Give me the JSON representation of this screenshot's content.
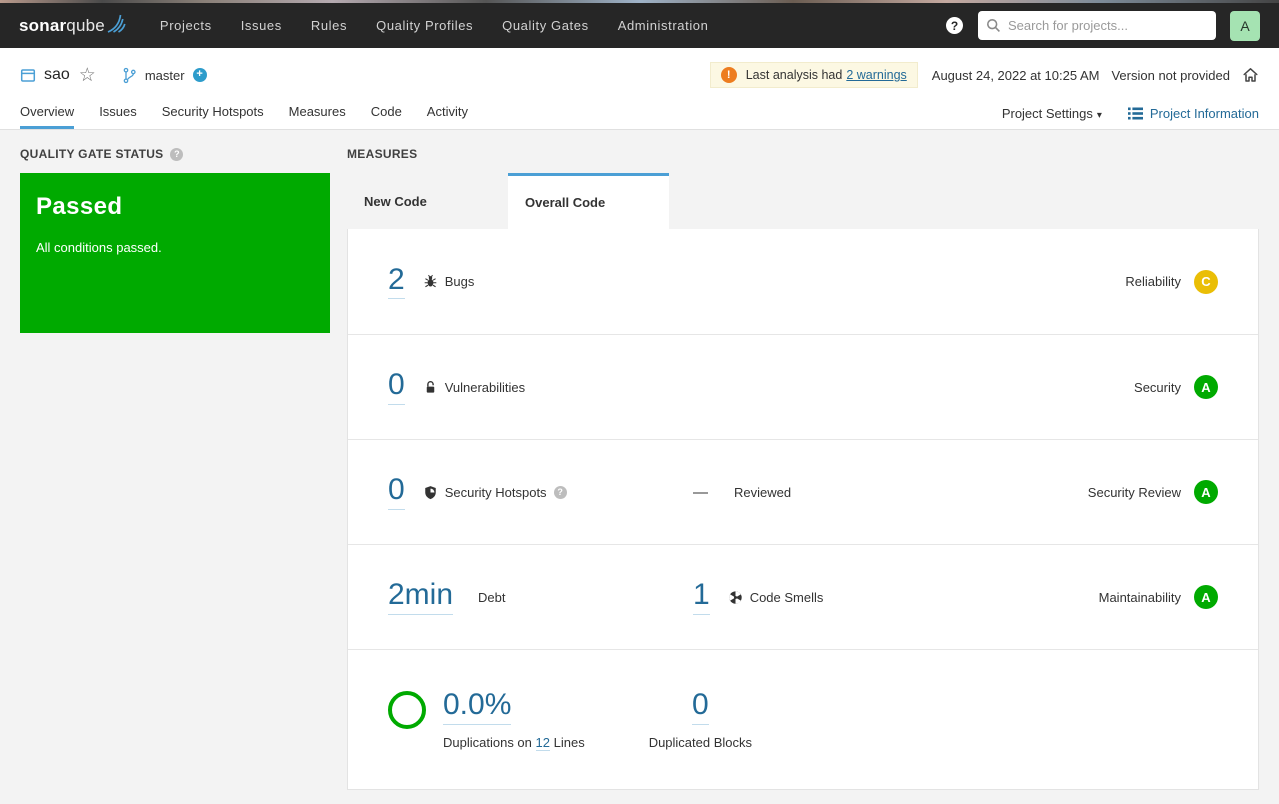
{
  "colors": {
    "navbar_bg": "#262626",
    "brand_blue": "#4b9fd5",
    "link_blue": "#236a97",
    "passed_green": "#00aa00",
    "rating_a": "#00aa00",
    "rating_c": "#eabe06",
    "warning_orange": "#ed7d20",
    "avatar_green": "#a5e3b2"
  },
  "icons": {
    "help": "?",
    "warning": "!",
    "star": "☆",
    "caret_down": "▾",
    "plus": "+"
  },
  "topnav": {
    "logo": {
      "bold": "sonar",
      "light": "qube"
    },
    "items": [
      {
        "label": "Projects"
      },
      {
        "label": "Issues"
      },
      {
        "label": "Rules"
      },
      {
        "label": "Quality Profiles"
      },
      {
        "label": "Quality Gates"
      },
      {
        "label": "Administration"
      }
    ],
    "search": {
      "placeholder": "Search for projects..."
    },
    "avatar": "A"
  },
  "header": {
    "project": "sao",
    "branch": "master",
    "warning": {
      "text": "Last analysis had",
      "link": "2 warnings"
    },
    "analysis_date": "August 24, 2022 at 10:25 AM",
    "version": "Version not provided",
    "tabs": [
      {
        "label": "Overview"
      },
      {
        "label": "Issues"
      },
      {
        "label": "Security Hotspots"
      },
      {
        "label": "Measures"
      },
      {
        "label": "Code"
      },
      {
        "label": "Activity"
      }
    ],
    "project_settings": "Project Settings",
    "project_information": "Project Information"
  },
  "quality_gate": {
    "heading": "QUALITY GATE STATUS",
    "status": "Passed",
    "description": "All conditions passed."
  },
  "measures": {
    "heading": "MEASURES",
    "tabs": [
      {
        "label": "New Code"
      },
      {
        "label": "Overall Code"
      }
    ],
    "rows": [
      {
        "value": "2",
        "metric": "Bugs",
        "domain": "Reliability",
        "rating": "C"
      },
      {
        "value": "0",
        "metric": "Vulnerabilities",
        "domain": "Security",
        "rating": "A"
      },
      {
        "value": "0",
        "metric": "Security Hotspots",
        "reviewed_value": "—",
        "reviewed_label": "Reviewed",
        "domain": "Security Review",
        "rating": "A"
      },
      {
        "value": "2min",
        "metric": "Debt",
        "secondary_value": "1",
        "secondary_metric": "Code Smells",
        "domain": "Maintainability",
        "rating": "A"
      },
      {
        "value": "0.0%",
        "label_prefix": "Duplications on",
        "lines_value": "12",
        "label_suffix": "Lines",
        "secondary_value": "0",
        "secondary_metric": "Duplicated Blocks"
      }
    ]
  }
}
